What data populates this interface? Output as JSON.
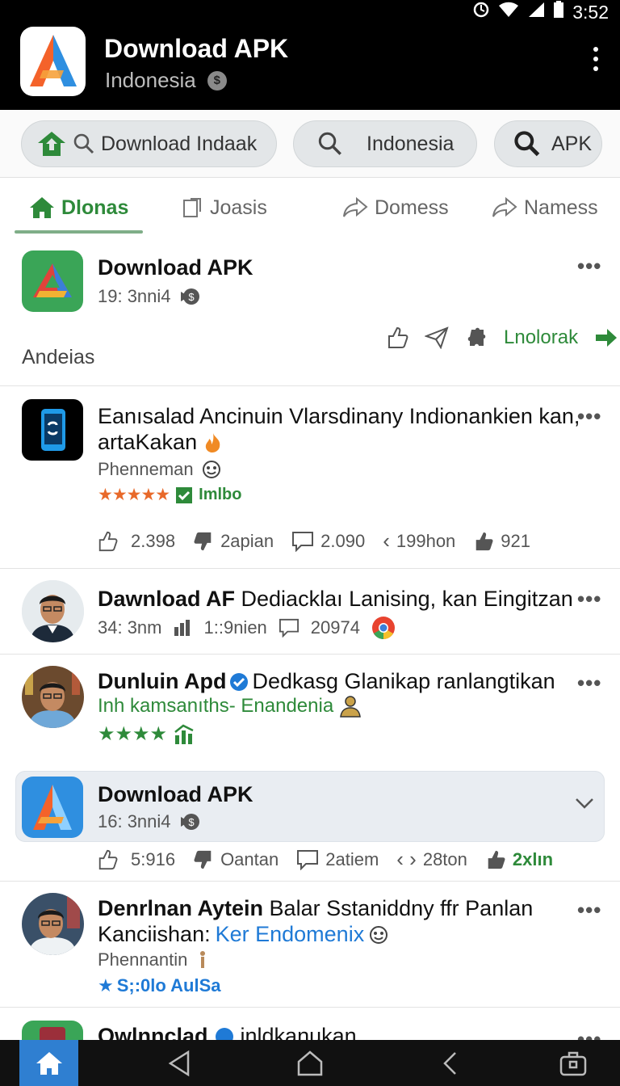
{
  "status": {
    "time": "3:52"
  },
  "header": {
    "title": "Download APK",
    "subtitle": "Indonesia",
    "coin_symbol": "$"
  },
  "search": {
    "pill1": "Download Indaak",
    "pill2": "Indonesia",
    "pill3": "APK"
  },
  "tabs": [
    {
      "label": "Dlonas"
    },
    {
      "label": "Joasis"
    },
    {
      "label": "Domess"
    },
    {
      "label": "Namess"
    }
  ],
  "cards": {
    "c1": {
      "title": "Download APK",
      "meta": "19: 3nni4",
      "footer_text": "Andeias",
      "action_label": "Lnolorak"
    },
    "c2": {
      "title_line1": "Eanısalad Ancinuin Vlarsdinany Indionankien kan,",
      "title_line2": "artaKakan",
      "author": "Phenneman",
      "stars": "★★★★★",
      "badge": "Imlbo",
      "a1": "2.398",
      "a2": "2apian",
      "a3": "2.090",
      "a4": "199hon",
      "a5": "921"
    },
    "c3": {
      "title_bold": "Dawnload AF",
      "title_rest": "Dediacklaı Lanising, kan Eingitzan",
      "meta1": "34: 3nm",
      "meta2": "1::9nien",
      "meta3": "20974"
    },
    "c4": {
      "title_bold": "Dunluin Apd",
      "title_rest": "Dedkasg Glanikap ranlangtikan",
      "subtitle": "Inh kamsanıths- Enandenia",
      "stars": "★★★★"
    },
    "c5": {
      "title": "Download APK",
      "meta": "16: 3nni4",
      "a1": "5:916",
      "a2": "Oantan",
      "a3": "2atiem",
      "a4": "28ton",
      "a5": "2xlın"
    },
    "c6": {
      "title_line1": "Denrlnan Aytein",
      "title_line1_rest": "Balar Sstaniddny ffr Panlan",
      "title_line2": "Kanciishan:",
      "title_line2_link": "Ker Endomenix",
      "author": "Phennantin",
      "rating": "S;:0lo AulSa"
    },
    "c7": {
      "title_bold": "Owlnnclad",
      "title_rest": "inldkanukan"
    }
  },
  "colors": {
    "accent_green": "#2e8a3a",
    "accent_blue": "#2f7fd1",
    "bar_black": "#000000"
  }
}
